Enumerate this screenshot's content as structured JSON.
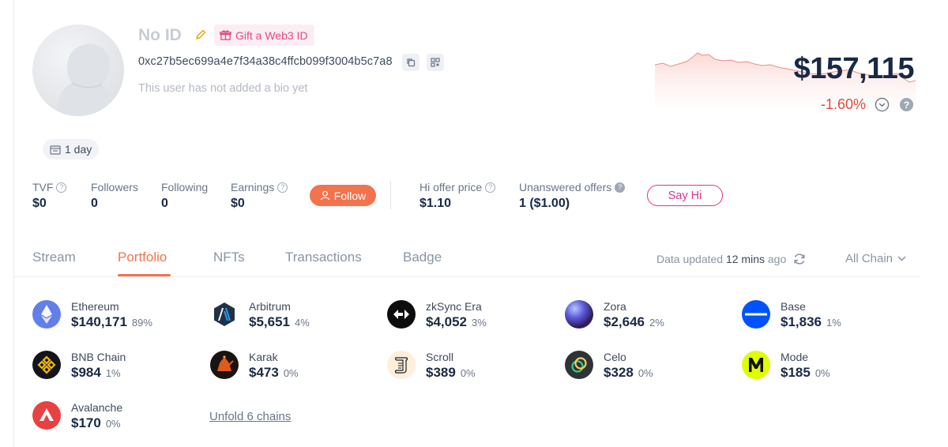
{
  "profile": {
    "name": "No ID",
    "gift_label": "Gift a Web3 ID",
    "address": "0xc27b5ec699a4e7f34a38c4ffcb099f3004b5c7a8",
    "bio": "This user has not added a bio yet",
    "age": "1 day"
  },
  "balance": {
    "value": "$157,115",
    "change": "-1.60%"
  },
  "stats": {
    "tvf_label": "TVF",
    "tvf_value": "$0",
    "followers_label": "Followers",
    "followers_value": "0",
    "following_label": "Following",
    "following_value": "0",
    "earnings_label": "Earnings",
    "earnings_value": "$0",
    "follow_label": "Follow",
    "hi_offer_label": "Hi offer price",
    "hi_offer_value": "$1.10",
    "unanswered_label": "Unanswered offers",
    "unanswered_value": "1 ($1.00)",
    "sayhi_label": "Say Hi"
  },
  "tabs": [
    "Stream",
    "Portfolio",
    "NFTs",
    "Transactions",
    "Badge"
  ],
  "active_tab": "Portfolio",
  "data_updated": {
    "prefix": "Data updated ",
    "time": "12 mins",
    "suffix": " ago"
  },
  "chain_filter": "All Chain",
  "assets": [
    {
      "name": "Ethereum",
      "value": "$140,171",
      "pct": "89%",
      "icon": "ethereum-icon"
    },
    {
      "name": "Arbitrum",
      "value": "$5,651",
      "pct": "4%",
      "icon": "arbitrum-icon"
    },
    {
      "name": "zkSync Era",
      "value": "$4,052",
      "pct": "3%",
      "icon": "zksync-icon"
    },
    {
      "name": "Zora",
      "value": "$2,646",
      "pct": "2%",
      "icon": "zora-icon"
    },
    {
      "name": "Base",
      "value": "$1,836",
      "pct": "1%",
      "icon": "base-icon"
    },
    {
      "name": "BNB Chain",
      "value": "$984",
      "pct": "1%",
      "icon": "bnb-icon"
    },
    {
      "name": "Karak",
      "value": "$473",
      "pct": "0%",
      "icon": "karak-icon"
    },
    {
      "name": "Scroll",
      "value": "$389",
      "pct": "0%",
      "icon": "scroll-icon"
    },
    {
      "name": "Celo",
      "value": "$328",
      "pct": "0%",
      "icon": "celo-icon"
    },
    {
      "name": "Mode",
      "value": "$185",
      "pct": "0%",
      "icon": "mode-icon"
    },
    {
      "name": "Avalanche",
      "value": "$170",
      "pct": "0%",
      "icon": "avalanche-icon"
    }
  ],
  "unfold_label": "Unfold 6 chains",
  "colors": {
    "accent": "#f2734d",
    "pink": "#e0328a",
    "negative": "#e0483b",
    "text": "#192945"
  }
}
